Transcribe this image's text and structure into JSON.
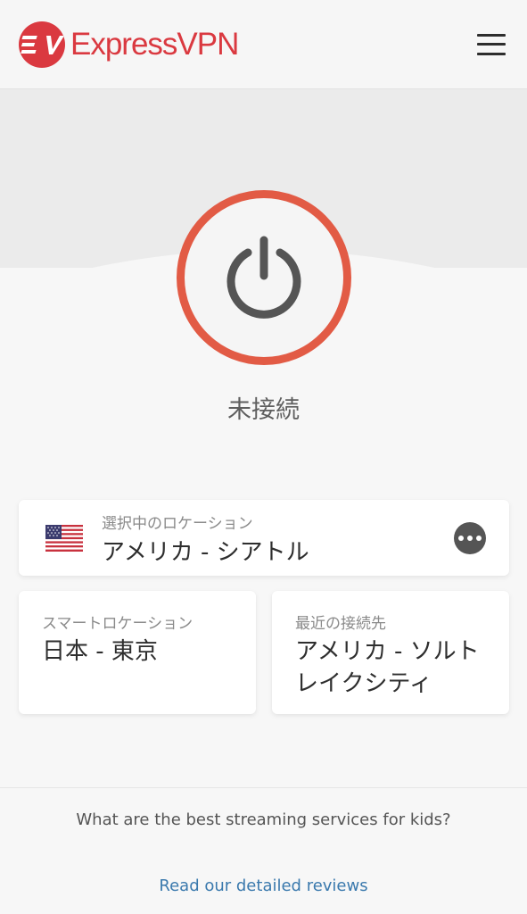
{
  "header": {
    "brand_name": "ExpressVPN",
    "logo_icon": "expressvpn-logo-icon",
    "menu_icon": "hamburger-menu-icon"
  },
  "power": {
    "icon": "power-icon",
    "status": "未接続"
  },
  "selected_location": {
    "label": "選択中のロケーション",
    "value": "アメリカ - シアトル",
    "flag_icon": "us-flag-icon",
    "more_icon": "more-options-icon"
  },
  "smart_location": {
    "label": "スマートロケーション",
    "value": "日本 - 東京"
  },
  "recent_connection": {
    "label": "最近の接続先",
    "value": "アメリカ - ソルトレイクシティ"
  },
  "footer": {
    "question": "What are the best streaming services for kids?",
    "link": "Read our detailed reviews"
  },
  "colors": {
    "brand_red": "#da3940",
    "ring": "#e25b45",
    "link": "#3a79ad"
  }
}
